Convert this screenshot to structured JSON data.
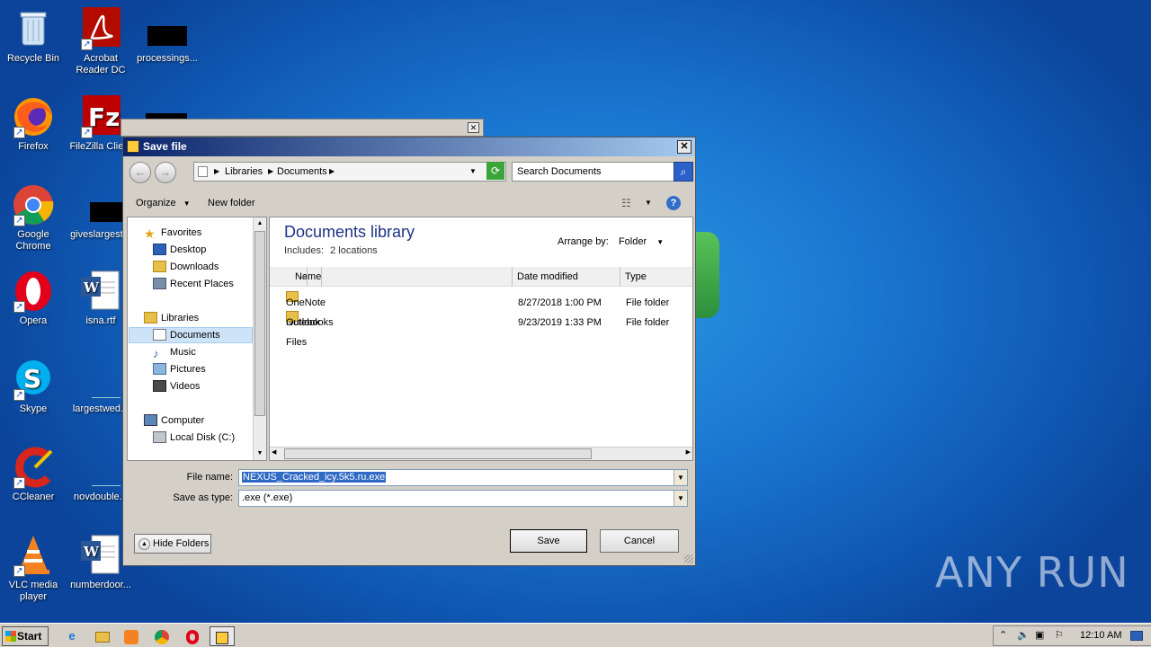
{
  "desktop": {
    "icons": [
      {
        "label": "Recycle Bin"
      },
      {
        "label": "Acrobat Reader DC"
      },
      {
        "label": "processings..."
      },
      {
        "label": "Firefox"
      },
      {
        "label": "FileZilla Client"
      },
      {
        "label": "Google Chrome"
      },
      {
        "label": "giveslargest..."
      },
      {
        "label": "Opera"
      },
      {
        "label": "isna.rtf"
      },
      {
        "label": "Skype"
      },
      {
        "label": "largestwed..."
      },
      {
        "label": "CCleaner"
      },
      {
        "label": "novdouble..."
      },
      {
        "label": "VLC media player"
      },
      {
        "label": "numberdoor..."
      }
    ]
  },
  "dialog": {
    "title": "Save file",
    "breadcrumb": [
      "Libraries",
      "Documents"
    ],
    "search_placeholder": "Search Documents",
    "toolbar": {
      "organize": "Organize",
      "new_folder": "New folder"
    },
    "nav": {
      "favorites": "Favorites",
      "desktop": "Desktop",
      "downloads": "Downloads",
      "recent": "Recent Places",
      "libraries": "Libraries",
      "documents": "Documents",
      "music": "Music",
      "pictures": "Pictures",
      "videos": "Videos",
      "computer": "Computer",
      "local_disk": "Local Disk (C:)"
    },
    "library": {
      "title": "Documents library",
      "includes": "Includes:",
      "locations": "2 locations",
      "arrange_label": "Arrange by:",
      "arrange_value": "Folder"
    },
    "columns": {
      "name": "Name",
      "date": "Date modified",
      "type": "Type"
    },
    "files": [
      {
        "name": "OneNote Notebooks",
        "date": "8/27/2018 1:00 PM",
        "type": "File folder"
      },
      {
        "name": "Outlook Files",
        "date": "9/23/2019 1:33 PM",
        "type": "File folder"
      }
    ],
    "file_name_label": "File name:",
    "file_name_value": "NEXUS_Cracked_icy.5k5.ru.exe",
    "save_type_label": "Save as type:",
    "save_type_value": ".exe (*.exe)",
    "hide_folders": "Hide Folders",
    "save": "Save",
    "cancel": "Cancel"
  },
  "taskbar": {
    "start": "Start",
    "clock": "12:10 AM"
  },
  "watermark": "ANY RUN"
}
